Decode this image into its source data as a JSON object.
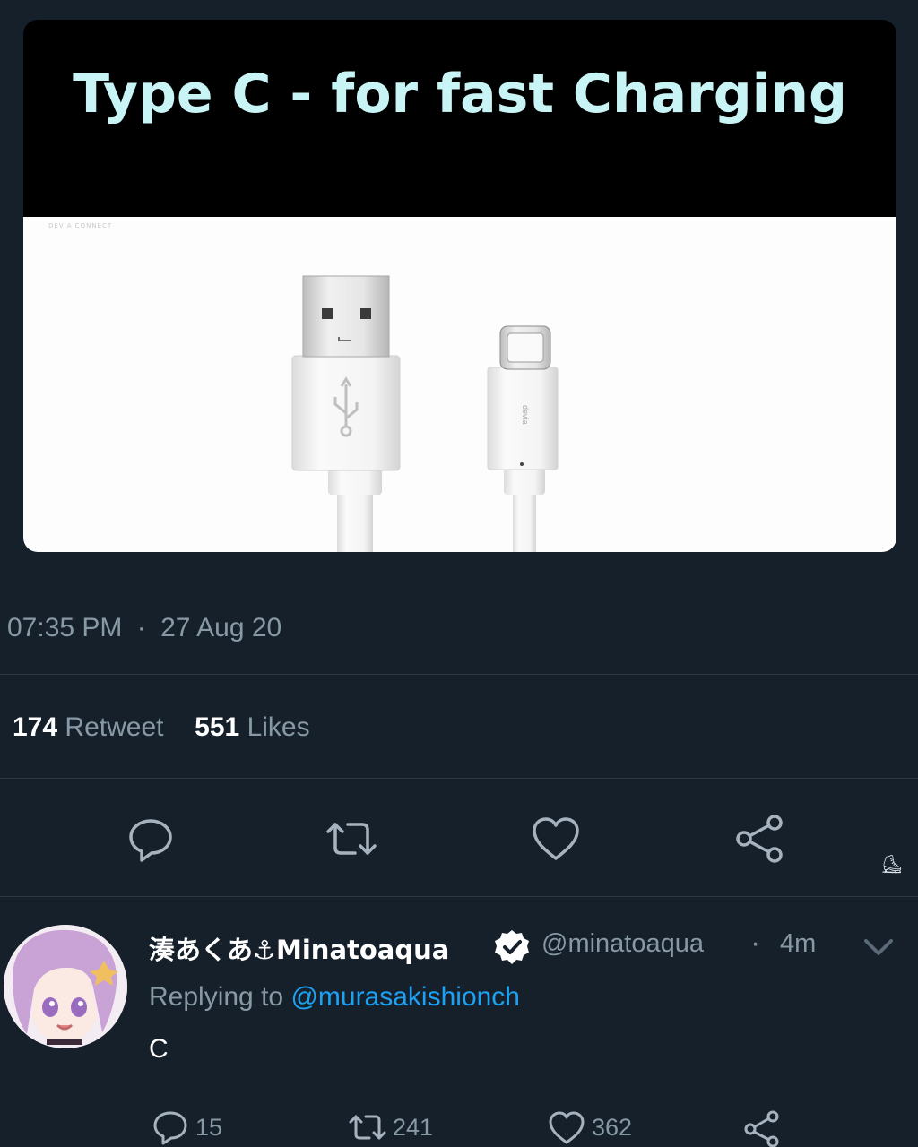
{
  "tweet": {
    "media": {
      "caption": "Type C - for fast Charging",
      "photo_brand": "DEVIA CONNECT",
      "cable_brand": "devia"
    },
    "time": "07:35 PM",
    "separator": "·",
    "date": "27 Aug 20",
    "retweets": "174",
    "retweet_label": "Retweet",
    "likes": "551",
    "likes_label": "Likes",
    "actions": [
      "reply-icon",
      "retweet-icon",
      "like-icon",
      "share-icon"
    ]
  },
  "reply": {
    "display_name": "湊あくあ⚓Minatoaqua",
    "handle": "@minatoaqua",
    "dot": "·",
    "time": "4m",
    "replying_prefix": "Replying to",
    "replying_to": "@murasakishionch",
    "text": "C",
    "reply_count": "15",
    "retweet_count": "241",
    "like_count": "362"
  },
  "stray_glyph": "⛸",
  "colors": {
    "background": "#15202b",
    "caption": "#c8f4f6",
    "accent": "#1da1f2",
    "muted": "#8899a6"
  }
}
